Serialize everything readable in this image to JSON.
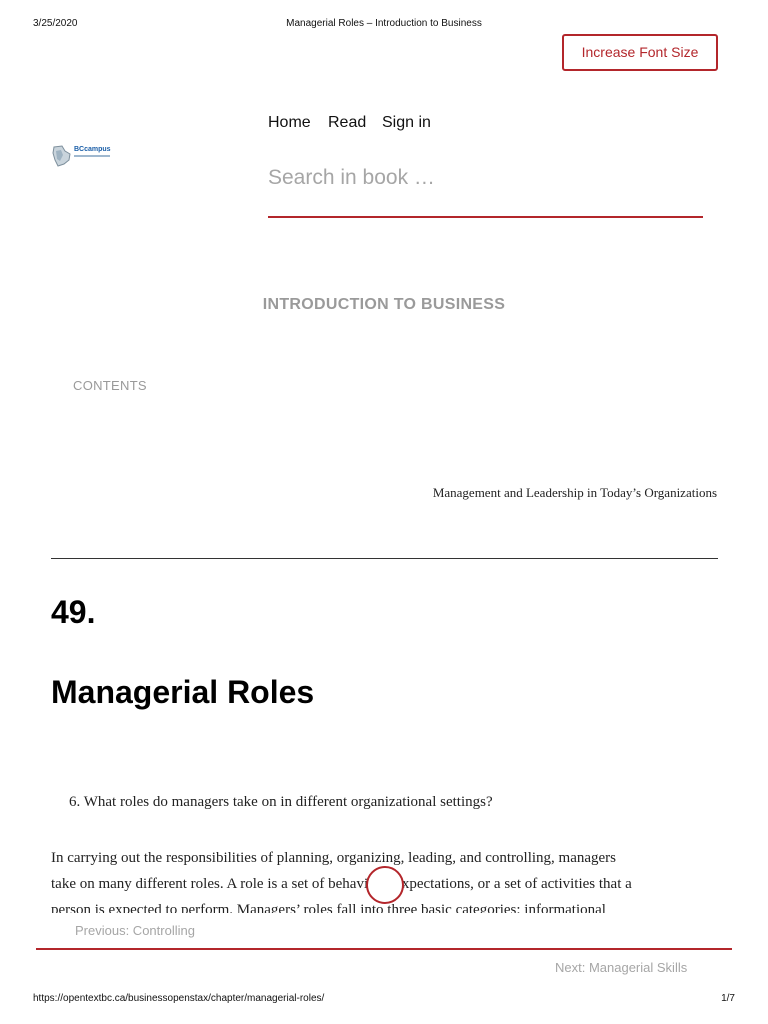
{
  "print_header": {
    "date": "3/25/2020",
    "title": "Managerial Roles – Introduction to Business"
  },
  "toolbar": {
    "font_size_label": "Increase Font Size"
  },
  "logo": {
    "text": "BCcampus"
  },
  "nav": {
    "items": [
      "Home",
      "Read",
      "Sign in"
    ]
  },
  "search": {
    "placeholder": "Search in book …",
    "value": ""
  },
  "book": {
    "title": "INTRODUCTION TO BUSINESS",
    "contents_label": "CONTENTS"
  },
  "chapter": {
    "part_title": "Management and Leadership in Today’s Organizations",
    "number": "49.",
    "title": "Managerial Roles",
    "objective": "6.  What roles do managers take on in different organizational settings?",
    "body_lines": [
      "In carrying out the responsibilities of planning, organizing, leading, and controlling, managers",
      "take on many different roles. A role is a set of behavioral expectations, or a set of activities that a",
      "person is expected to perform. Managers’ roles fall into three basic categories: informational"
    ]
  },
  "pagination": {
    "previous": "Previous: Controlling",
    "next": "Next: Managerial Skills"
  },
  "print_footer": {
    "url": "https://opentextbc.ca/businessopenstax/chapter/managerial-roles/",
    "page": "1/7"
  },
  "colors": {
    "accent": "#b3262b",
    "muted": "#9a9a9a"
  }
}
